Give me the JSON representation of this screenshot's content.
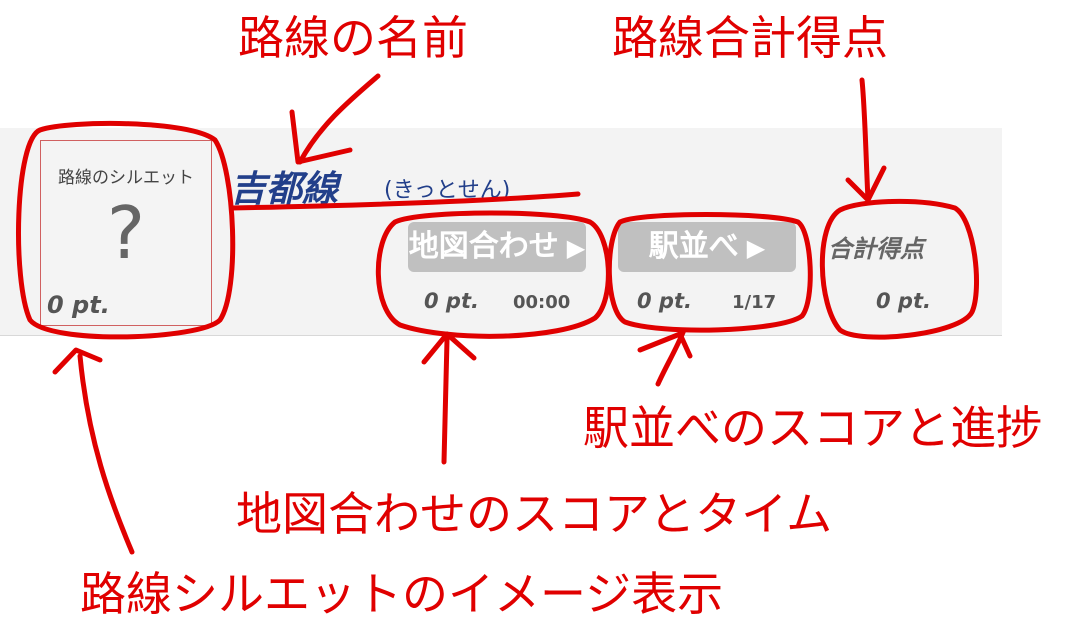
{
  "annotations": {
    "line_name": "路線の名前",
    "line_total": "路線合計得点",
    "ordering": "駅並べのスコアと進捗",
    "map_match": "地図合わせのスコアとタイム",
    "silhouette": "路線シルエットのイメージ表示"
  },
  "card": {
    "silhouette": {
      "title": "路線のシルエット",
      "placeholder": "?",
      "score": "0 pt."
    },
    "line_name": "吉都線",
    "line_reading": "(きっとせん)",
    "map_game": {
      "label": "地図合わせ",
      "arrow": "▶",
      "score": "0 pt.",
      "time": "00:00"
    },
    "order_game": {
      "label": "駅並べ",
      "arrow": "▶",
      "score": "0 pt.",
      "progress": "1/17"
    },
    "total": {
      "label": "合計得点",
      "score": "0 pt."
    }
  },
  "colors": {
    "annotation": "#e00000",
    "line_name": "#223f8a",
    "button": "#c0c0c0"
  }
}
